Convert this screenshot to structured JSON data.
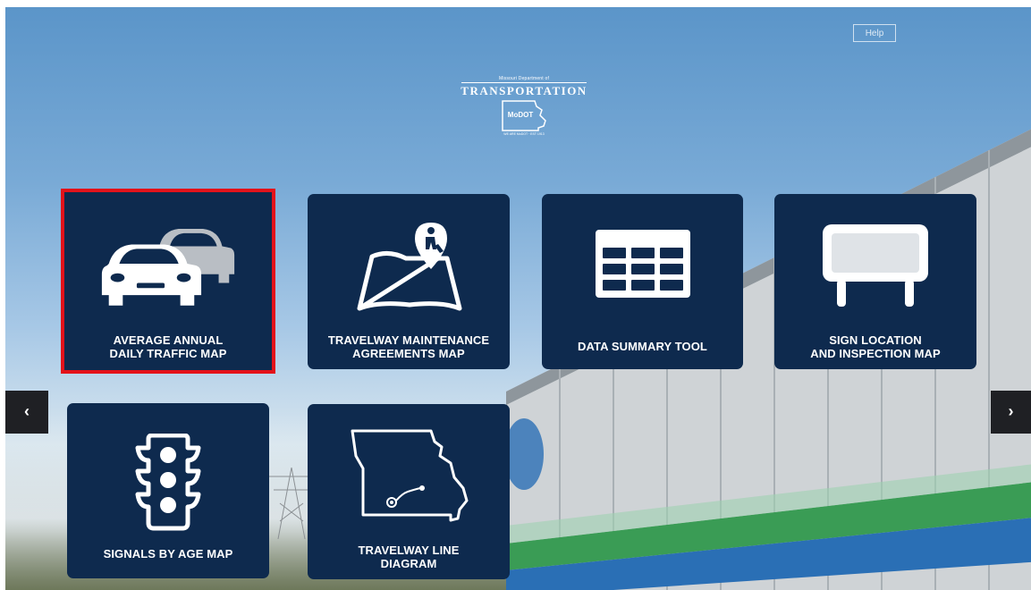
{
  "header": {
    "help_label": "Help",
    "logo": {
      "small_text": "Missouri Department of",
      "title": "TRANSPORTATION",
      "mark": "MoDOT",
      "tagline": "WE ARE MoDOT · EST 1913"
    }
  },
  "tiles": [
    {
      "label_line1": "AVERAGE ANNUAL",
      "label_line2": "DAILY TRAFFIC MAP",
      "icon": "cars-icon",
      "selected": true
    },
    {
      "label_line1": "TRAVELWAY MAINTENANCE",
      "label_line2": "AGREEMENTS MAP",
      "icon": "map-worker-pin-icon"
    },
    {
      "label_line1": "DATA SUMMARY TOOL",
      "label_line2": "",
      "icon": "table-grid-icon"
    },
    {
      "label_line1": "SIGN LOCATION",
      "label_line2": "AND INSPECTION MAP",
      "icon": "billboard-sign-icon"
    },
    {
      "label_line1": "SIGNALS BY AGE MAP",
      "label_line2": "",
      "icon": "traffic-light-icon"
    },
    {
      "label_line1": "TRAVELWAY LINE",
      "label_line2": "DIAGRAM",
      "icon": "missouri-map-line-icon"
    }
  ],
  "nav": {
    "prev_glyph": "‹",
    "next_glyph": "›"
  },
  "colors": {
    "tile_bg": "#0e2a4e",
    "selected_border": "#e3121a",
    "arrow_bg": "#1f2024"
  }
}
